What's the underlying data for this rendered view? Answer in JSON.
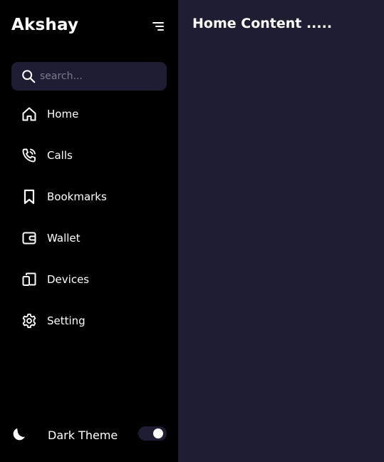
{
  "sidebar": {
    "brand": "Akshay",
    "menu_icon": "menu-lines-icon",
    "search": {
      "placeholder": "search...",
      "value": "",
      "icon": "search-icon"
    },
    "items": [
      {
        "label": "Home",
        "icon": "home-icon"
      },
      {
        "label": "Calls",
        "icon": "phone-icon"
      },
      {
        "label": "Bookmarks",
        "icon": "bookmark-icon"
      },
      {
        "label": "Wallet",
        "icon": "wallet-icon"
      },
      {
        "label": "Devices",
        "icon": "devices-icon"
      },
      {
        "label": "Setting",
        "icon": "gear-icon"
      }
    ],
    "theme": {
      "label": "Dark Theme",
      "icon": "moon-icon",
      "enabled": true
    }
  },
  "main": {
    "title": "Home Content ....."
  },
  "colors": {
    "sidebar_bg": "#000000",
    "content_bg": "#1f1d33",
    "text": "#ffffff",
    "placeholder": "#7d7b8d"
  }
}
